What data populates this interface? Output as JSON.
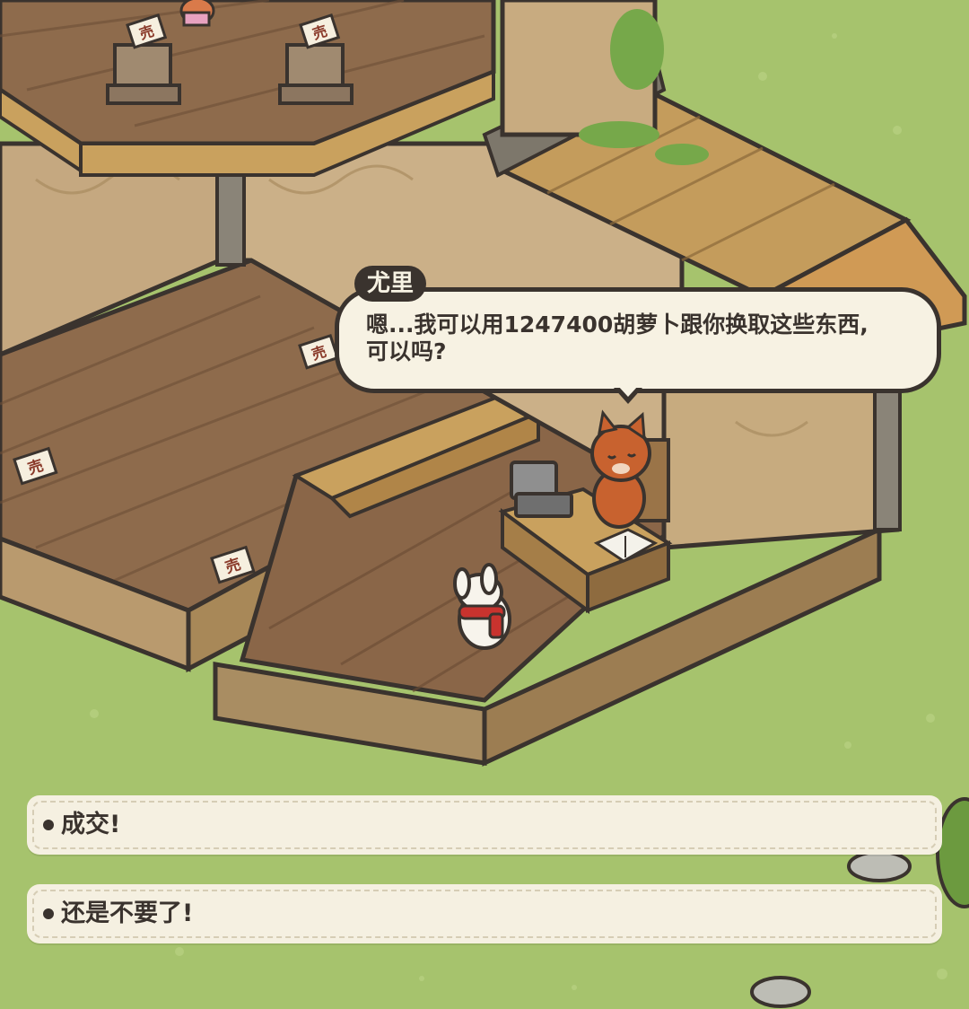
{
  "dialogue": {
    "speaker": "尤里",
    "line1": "嗯...我可以用1247400胡萝卜跟你换取这些东西,",
    "line2": "可以吗?"
  },
  "choices": [
    {
      "label": "成交!"
    },
    {
      "label": "还是不要了!"
    }
  ],
  "signs": {
    "sell_label": "売"
  },
  "colors": {
    "grass": "#a6c36d",
    "wood_floor": "#8b6a4c",
    "wood_wall": "#c7ab83",
    "outline": "#3a332e",
    "bubble_bg": "#f7f2e3",
    "choice_bg": "#f5f0e1",
    "fox": "#c8622f",
    "scarf": "#c9332e"
  }
}
